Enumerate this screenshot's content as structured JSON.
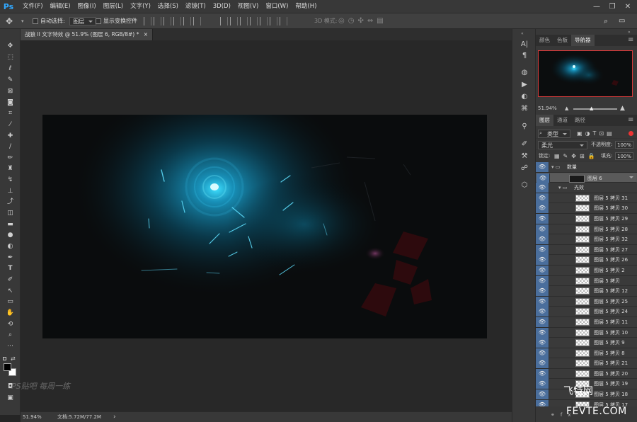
{
  "app": {
    "logo": "Ps"
  },
  "menus": [
    "文件(F)",
    "编辑(E)",
    "图像(I)",
    "图层(L)",
    "文字(Y)",
    "选择(S)",
    "滤镜(T)",
    "3D(D)",
    "视图(V)",
    "窗口(W)",
    "帮助(H)"
  ],
  "window_controls": {
    "minimize": "—",
    "restore": "❐",
    "close": "✕"
  },
  "options_bar": {
    "auto_select_label": "自动选择:",
    "auto_select_value": "图层",
    "show_transform_label": "显示变换控件",
    "mode_3d_label": "3D 模式:"
  },
  "document": {
    "tab_title": "战狼 II 文字特效 @ 51.9% (图层 6, RGB/8#) *",
    "close": "×"
  },
  "status": {
    "zoom": "51.94%",
    "doc_info": "文档:5.72M/77.2M",
    "arrow": "›"
  },
  "watermark_left": "PS贴吧 每周一练",
  "panels": {
    "top_tabs": [
      "颜色",
      "色板",
      "导航器"
    ],
    "active_top_tab": "导航器",
    "nav_zoom": "51.94%",
    "layer_tabs": [
      "图层",
      "通道",
      "路径"
    ],
    "active_layer_tab": "图层",
    "filter_kind": "类型",
    "blend_mode": "柔光",
    "opacity_label": "不透明度:",
    "opacity_value": "100%",
    "lock_label": "锁定:",
    "fill_label": "填充:",
    "fill_value": "100%",
    "layers": [
      {
        "name": "数量",
        "type": "group",
        "indent": 0
      },
      {
        "name": "图层 6",
        "type": "layer-dark",
        "indent": 1,
        "selected": true
      },
      {
        "name": "光效",
        "type": "group",
        "indent": 1
      },
      {
        "name": "图层 5 拷贝 31",
        "type": "layer",
        "indent": 2
      },
      {
        "name": "图层 5 拷贝 30",
        "type": "layer",
        "indent": 2
      },
      {
        "name": "图层 5 拷贝 29",
        "type": "layer",
        "indent": 2
      },
      {
        "name": "图层 5 拷贝 28",
        "type": "layer",
        "indent": 2
      },
      {
        "name": "图层 5 拷贝 32",
        "type": "layer",
        "indent": 2
      },
      {
        "name": "图层 5 拷贝 27",
        "type": "layer",
        "indent": 2
      },
      {
        "name": "图层 5 拷贝 26",
        "type": "layer",
        "indent": 2
      },
      {
        "name": "图层 5 拷贝 2",
        "type": "layer",
        "indent": 2
      },
      {
        "name": "图层 5 拷贝",
        "type": "layer",
        "indent": 2
      },
      {
        "name": "图层 5 拷贝 12",
        "type": "layer",
        "indent": 2
      },
      {
        "name": "图层 5 拷贝 25",
        "type": "layer",
        "indent": 2
      },
      {
        "name": "图层 5 拷贝 24",
        "type": "layer",
        "indent": 2
      },
      {
        "name": "图层 5 拷贝 11",
        "type": "layer",
        "indent": 2
      },
      {
        "name": "图层 5 拷贝 10",
        "type": "layer",
        "indent": 2
      },
      {
        "name": "图层 5 拷贝 9",
        "type": "layer",
        "indent": 2
      },
      {
        "name": "图层 5 拷贝 8",
        "type": "layer",
        "indent": 2
      },
      {
        "name": "图层 5 拷贝 21",
        "type": "layer",
        "indent": 2
      },
      {
        "name": "图层 5 拷贝 20",
        "type": "layer",
        "indent": 2
      },
      {
        "name": "图层 5 拷贝 19",
        "type": "layer",
        "indent": 2
      },
      {
        "name": "图层 5 拷贝 18",
        "type": "layer",
        "indent": 2
      },
      {
        "name": "图层 5 拷贝 17",
        "type": "layer",
        "indent": 2
      }
    ]
  },
  "watermark_right": {
    "line1": "飞特网",
    "line2": "FEVTE.COM"
  },
  "colors": {
    "ui_bg": "#383838",
    "canvas_bg": "#0b0d0e",
    "glow": "#1aa7d6",
    "eye_col": "#4a6e9c",
    "nav_border": "#d53a3a"
  }
}
